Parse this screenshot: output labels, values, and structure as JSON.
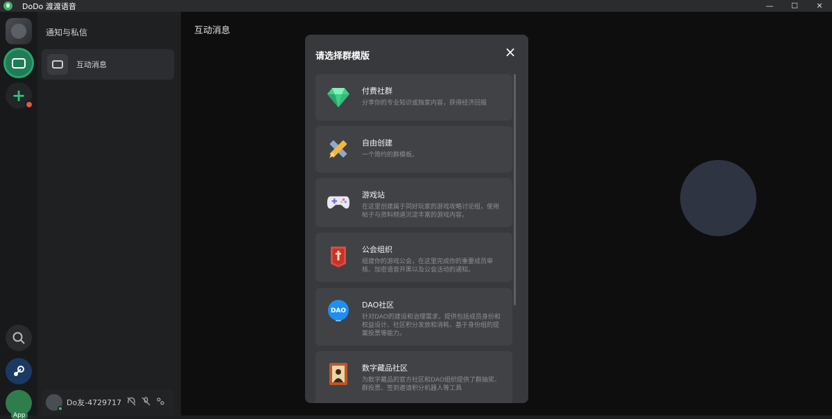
{
  "window": {
    "title": "DoDo 渡渡语音",
    "min_icon": "minimize-icon",
    "max_icon": "maximize-icon",
    "close_icon": "close-window-icon"
  },
  "rail": {
    "items": [
      "user-avatar",
      "messages-icon",
      "add-server-icon",
      "search-icon",
      "steam-icon",
      "app-icon"
    ],
    "app_label": "App"
  },
  "panel": {
    "title": "通知与私信",
    "item_label": "互动消息"
  },
  "user": {
    "name": "Do友-4729717"
  },
  "main": {
    "title": "互动消息"
  },
  "modal": {
    "title": "请选择群模版",
    "close": "×",
    "templates": [
      {
        "name": "付费社群",
        "desc": "分享你的专业知识或独家内容，获得经济回报",
        "icon": "diamond-icon"
      },
      {
        "name": "自由创建",
        "desc": "一个简约的群模板。",
        "icon": "pencil-ruler-icon"
      },
      {
        "name": "游戏站",
        "desc": "在这里创建属于同好玩家的游戏攻略讨论组，使用帖子与资料频道沉淀丰富的游戏内容。",
        "icon": "gamepad-icon"
      },
      {
        "name": "公会组织",
        "desc": "组建你的游戏公会，在这里完成你的重要成员审核、加密语音开黑以及公会活动的通知。",
        "icon": "guild-banner-icon"
      },
      {
        "name": "DAO社区",
        "desc": "针对DAO的建设和治理需求，提供包括成员身份和权益设计、社区积分发放和消耗、基于身份组的提案投票等能力。",
        "icon": "dao-icon",
        "icon_text": "DAO"
      },
      {
        "name": "数字藏品社区",
        "desc": "为数字藏品的官方社区和DAO组织提供了群抽奖、群投票、签到邀请积分机器人等工具",
        "icon": "portrait-icon"
      }
    ]
  }
}
